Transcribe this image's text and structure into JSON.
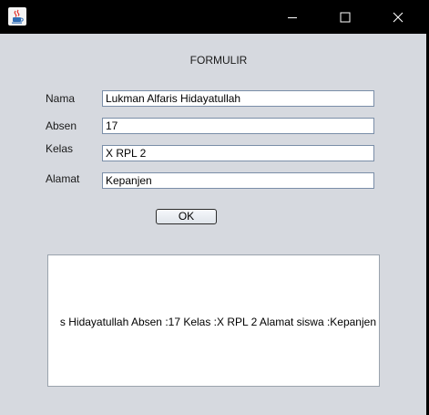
{
  "window": {
    "controls": {
      "minimize": "minimize-icon",
      "maximize": "maximize-icon",
      "close": "close-icon"
    },
    "app_icon": "java-coffee-cup-icon"
  },
  "form": {
    "title": "FORMULIR",
    "fields": {
      "nama": {
        "label": "Nama",
        "value": "Lukman Alfaris Hidayatullah"
      },
      "absen": {
        "label": "Absen",
        "value": "17"
      },
      "kelas": {
        "label": "Kelas",
        "value": "X RPL 2"
      },
      "alamat": {
        "label": "Alamat",
        "value": "Kepanjen"
      }
    },
    "ok_label": "OK"
  },
  "output": {
    "text": "s Hidayatullah Absen :17 Kelas :X RPL 2 Alamat siswa :Kepanjen"
  },
  "colors": {
    "background": "#d6d9df",
    "titlebar": "#000000",
    "field_border": "#7a8ea8"
  }
}
